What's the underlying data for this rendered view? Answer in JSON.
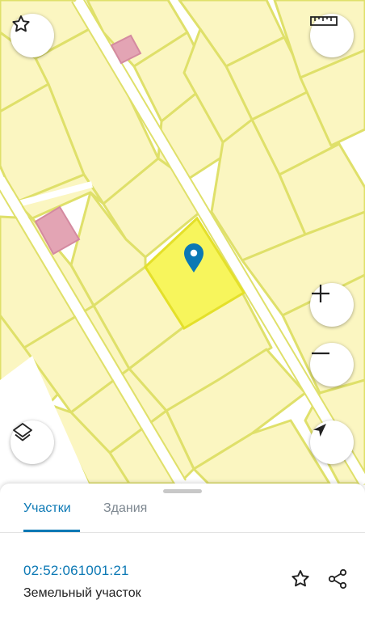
{
  "map": {
    "colors": {
      "parcel_fill": "#fbf6c1",
      "parcel_border": "#dfe06a",
      "selected_fill": "#f7f55c",
      "selected_border": "#e4e02a",
      "building_fill": "#e3a4b4",
      "building_border": "#d48aa0",
      "road": "#ffffff",
      "marker": "#0b78b4"
    },
    "controls": {
      "favorite": "star-icon",
      "measure": "ruler-icon",
      "zoom_in": "plus-icon",
      "zoom_out": "minus-icon",
      "layers": "layers-icon",
      "locate": "navigation-arrow-icon"
    }
  },
  "sheet": {
    "tabs": [
      {
        "label": "Участки",
        "active": true
      },
      {
        "label": "Здания",
        "active": false
      }
    ],
    "parcel": {
      "cadastral_number": "02:52:061001:21",
      "type": "Земельный участок"
    },
    "actions": [
      "star-icon",
      "share-icon"
    ]
  }
}
